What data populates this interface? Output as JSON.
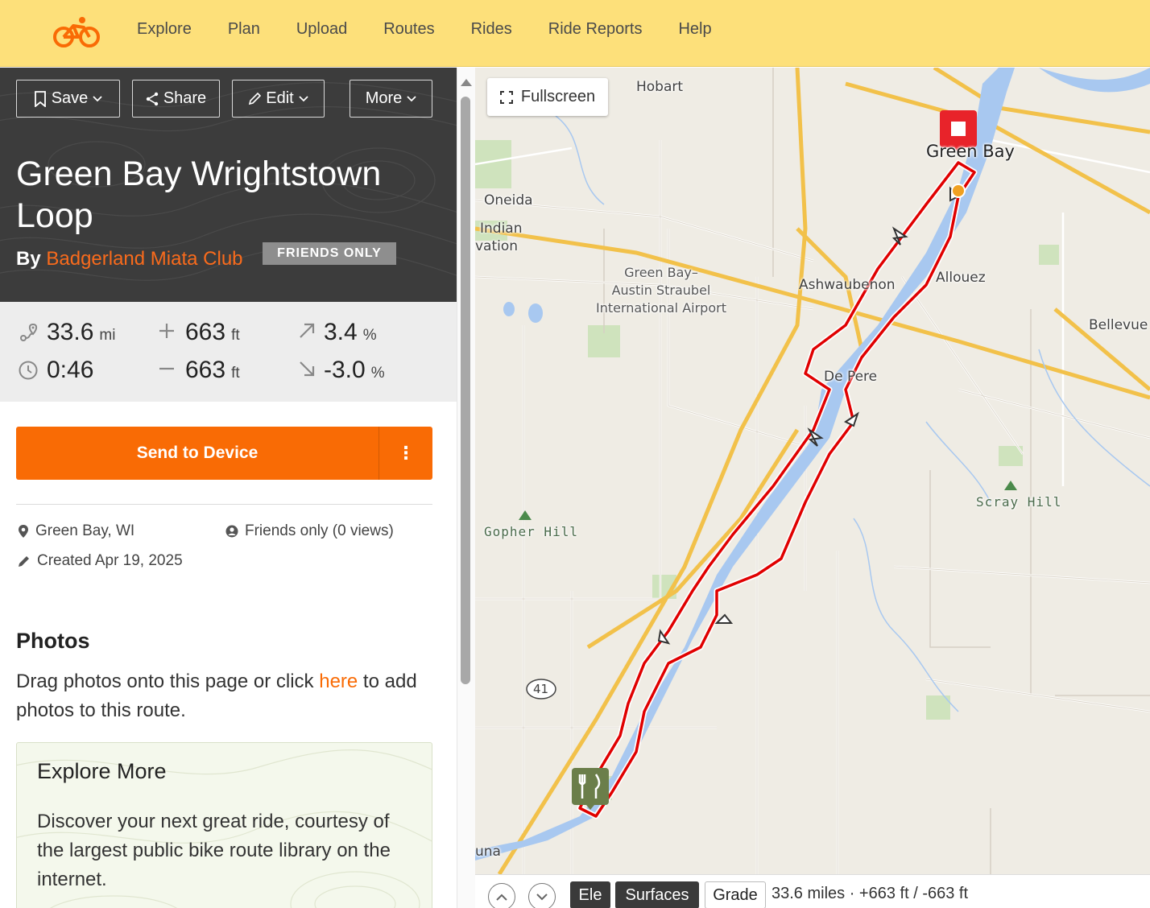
{
  "nav": {
    "logo": "bicycle-logo-icon",
    "items": [
      "Explore",
      "Plan",
      "Upload",
      "Routes",
      "Rides",
      "Ride Reports",
      "Help"
    ]
  },
  "toolbar": {
    "save": "Save",
    "share": "Share",
    "edit": "Edit",
    "more": "More"
  },
  "route": {
    "title": "Green Bay Wrightstown Loop",
    "by": "By",
    "author": "Badgerland Miata Club",
    "badge": "FRIENDS ONLY"
  },
  "stats": {
    "distance": {
      "value": "33.6",
      "unit": "mi"
    },
    "time": {
      "value": "0:46"
    },
    "gain": {
      "value": "663",
      "unit": "ft"
    },
    "loss": {
      "value": "663",
      "unit": "ft"
    },
    "max_grade": {
      "value": "3.4",
      "unit": "%"
    },
    "min_grade": {
      "value": "-3.0",
      "unit": "%"
    }
  },
  "actions": {
    "send": "Send to Device",
    "more": "⋮"
  },
  "meta": {
    "location": "Green Bay, WI",
    "privacy": "Friends only (0 views)",
    "created": "Created Apr 19, 2025"
  },
  "photos": {
    "heading": "Photos",
    "text_before": "Drag photos onto this page or click ",
    "link": "here",
    "text_after": " to add photos to this route."
  },
  "explore": {
    "heading": "Explore More",
    "text": "Discover your next great ride, courtesy of the largest public bike route library on the internet."
  },
  "map": {
    "fullscreen": "Fullscreen",
    "labels": {
      "hobart": "Hobart",
      "green_bay": "Green Bay",
      "oneida": "Oneida",
      "indian": "Indian",
      "vation": "vation",
      "airport": "Green Bay–\nAustin Straubel\nInternational Airport",
      "ashwaubenon": "Ashwaubenon",
      "allouez": "Allouez",
      "bellevue": "Bellevue",
      "de_pere": "De Pere",
      "scray_hill": "Scray Hill",
      "gopher_hill": "Gopher Hill",
      "hwy_41": "41",
      "una": "una"
    },
    "route_color": "#e00000",
    "water_color": "#a8c8f0"
  },
  "bottom": {
    "ele": "Ele",
    "surfaces": "Surfaces",
    "grade": "Grade",
    "summary": "33.6 miles · +663 ft / -663 ft"
  }
}
